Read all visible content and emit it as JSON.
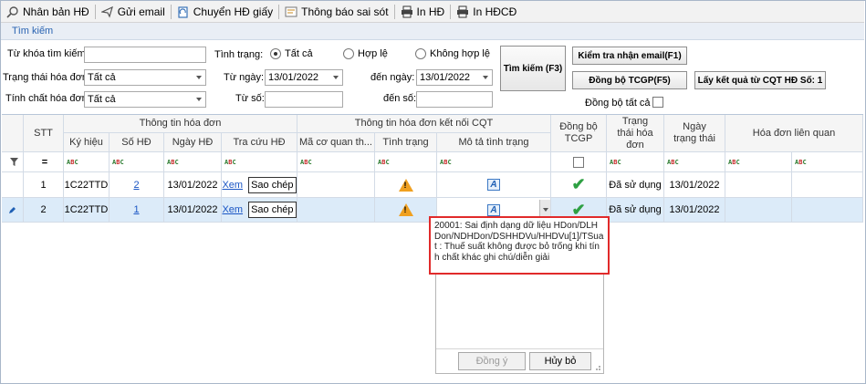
{
  "toolbar": {
    "buttons": [
      {
        "label": "Nhân bản HĐ",
        "icon": "search-icon"
      },
      {
        "label": "Gửi email",
        "icon": "send-icon"
      },
      {
        "label": "Chuyển HĐ giấy",
        "icon": "convert-icon"
      },
      {
        "label": "Thông báo sai sót",
        "icon": "notice-icon"
      },
      {
        "label": "In HĐ",
        "icon": "printer-icon"
      },
      {
        "label": "In HĐCĐ",
        "icon": "printer-icon"
      }
    ]
  },
  "search": {
    "title": "Tìm kiếm",
    "keyword_label": "Từ khóa tìm kiếm:",
    "keyword_value": "",
    "status_label": "Tình trạng:",
    "radio_all": "Tất cả",
    "radio_valid": "Hợp lệ",
    "radio_invalid": "Không hợp lệ",
    "invoice_status_label": "Trạng thái hóa đơn:",
    "invoice_status_value": "Tất cả",
    "invoice_nature_label": "Tính chất hóa đơn:",
    "invoice_nature_value": "Tất cả",
    "from_date_label": "Từ ngày:",
    "from_date_value": "13/01/2022",
    "to_date_label": "đến ngày:",
    "to_date_value": "13/01/2022",
    "from_no_label": "Từ số:",
    "to_no_label": "đến số:",
    "search_button": "Tìm kiếm (F3)",
    "check_email_button": "Kiểm tra nhận email(F1)",
    "sync_button": "Đồng bộ TCGP(F5)",
    "get_result_button": "Lấy kết quả từ CQT HĐ Số: 1",
    "sync_all_label": "Đồng bộ tất cả"
  },
  "grid": {
    "group_headers": {
      "invoice_info": "Thông tin hóa đơn",
      "cqt_info": "Thông tin hóa đơn kết nối CQT"
    },
    "columns": {
      "stt": "STT",
      "symbol": "Ký hiệu",
      "number": "Số HĐ",
      "date": "Ngày HĐ",
      "lookup": "Tra cứu HĐ",
      "cqt_code": "Mã cơ quan th...",
      "condition": "Tình trạng",
      "condition_desc": "Mô tả tình trạng",
      "sync_tcgp": "Đồng bộ TCGP",
      "invoice_state": "Trạng thái hóa đơn",
      "state_date": "Ngày trạng thái",
      "related": "Hóa đơn liên quan"
    },
    "filter_row_symbol": "=",
    "filter_abc": "ABC",
    "rows": [
      {
        "stt": "1",
        "symbol": "1C22TTD",
        "number": "2",
        "date": "13/01/2022",
        "lookup": "Xem",
        "copy": "Sao chép",
        "state": "Đã sử dụng",
        "state_date": "13/01/2022"
      },
      {
        "stt": "2",
        "symbol": "1C22TTD",
        "number": "1",
        "date": "13/01/2022",
        "lookup": "Xem",
        "copy": "Sao chép",
        "state": "Đã sử dụng",
        "state_date": "13/01/2022"
      }
    ]
  },
  "popup": {
    "message": "20001: Sai định dạng dữ liệu HDon/DLHDon/NDHDon/DSHHDVu/HHDVu[1]/TSuat : Thuế suất không được bỏ trống khi tính chất khác ghi chú/diễn giải",
    "ok_button": "Đồng ý",
    "cancel_button": "Hủy bỏ"
  },
  "colors": {
    "accent_blue": "#2a64b2",
    "selected_row": "#dcebf9",
    "error_border": "#e12a2a",
    "success_green": "#2ea043",
    "warning_orange": "#f0a020"
  }
}
